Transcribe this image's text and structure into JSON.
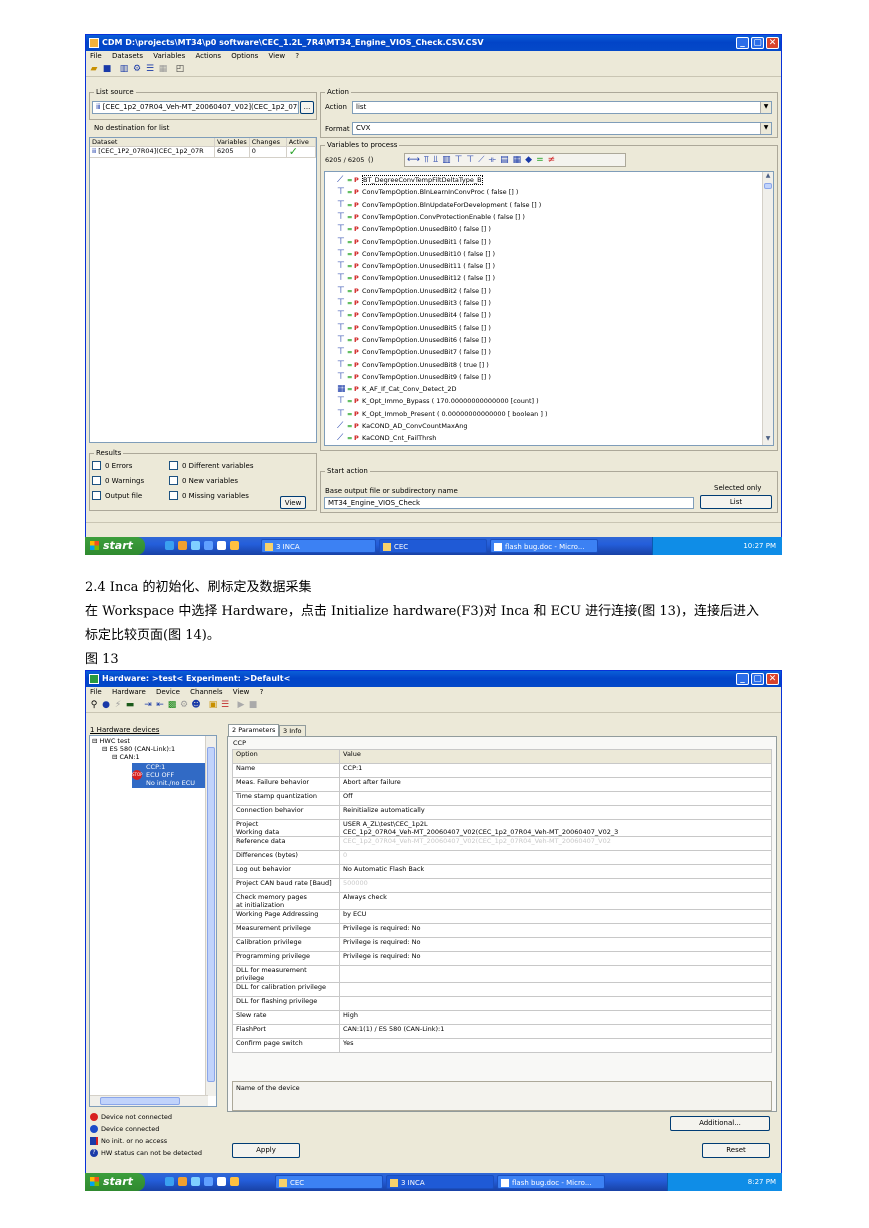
{
  "win1": {
    "title": "CDM D:\\projects\\MT34\\p0 software\\CEC_1.2L_7R4\\MT34_Engine_VIOS_Check.CSV.CSV",
    "menu": [
      "File",
      "Datasets",
      "Variables",
      "Actions",
      "Options",
      "View",
      "?"
    ],
    "list_source": {
      "label": "List source",
      "value": "[CEC_1p2_07R04_Veh-MT_20060407_V02](CEC_1p2_07R",
      "browse": "..."
    },
    "destination": {
      "label": "No destination for list"
    },
    "dataset_table": {
      "headers": [
        "Dataset",
        "Variables",
        "Changes",
        "Active"
      ],
      "rows": [
        {
          "name": "[CEC_1P2_07R04](CEC_1p2_07R",
          "variables": "6205",
          "changes": "0",
          "active": "✓"
        }
      ]
    },
    "results": {
      "label": "Results",
      "items": [
        "0 Errors",
        "0 Different variables",
        "0 Warnings",
        "0 New variables",
        "Output file",
        "0 Missing variables"
      ],
      "view_button": "View"
    },
    "action": {
      "group_label": "Action",
      "action_label": "Action",
      "action_value": "list",
      "format_label": "Format",
      "format_value": "CVX"
    },
    "variables": {
      "group_label": "Variables to process",
      "count": "6205 / 6205",
      "paren": "()",
      "items": [
        "BT_DegreeConvTempFiltDeltaType_B",
        "ConvTempOption.BlnLearnInConvProc ( false [] )",
        "ConvTempOption.BlnUpdateForDevelopment ( false [] )",
        "ConvTempOption.ConvProtectionEnable ( false [] )",
        "ConvTempOption.UnusedBit0 ( false [] )",
        "ConvTempOption.UnusedBit1 ( false [] )",
        "ConvTempOption.UnusedBit10 ( false [] )",
        "ConvTempOption.UnusedBit11 ( false [] )",
        "ConvTempOption.UnusedBit12 ( false [] )",
        "ConvTempOption.UnusedBit2 ( false [] )",
        "ConvTempOption.UnusedBit3 ( false [] )",
        "ConvTempOption.UnusedBit4 ( false [] )",
        "ConvTempOption.UnusedBit5 ( false [] )",
        "ConvTempOption.UnusedBit6 ( false [] )",
        "ConvTempOption.UnusedBit7 ( false [] )",
        "ConvTempOption.UnusedBit8 ( true [] )",
        "ConvTempOption.UnusedBit9 ( false [] )",
        "K_AF_If_Cat_Conv_Detect_2D",
        "K_Opt_Immo_Bypass ( 170.00000000000000 [count] )",
        "K_Opt_Immob_Present ( 0.00000000000000 [ boolean ] )",
        "KaCOND_AD_ConvCountMaxAng",
        "KaCOND_Cnt_FailThrsh"
      ]
    },
    "start_action": {
      "label": "Start action",
      "base_label": "Base output file or subdirectory name",
      "base_value": "MT34_Engine_VIOS_Check",
      "selected_only": "Selected only",
      "list_button": "List"
    }
  },
  "taskbar1": {
    "start": "start",
    "tasks": [
      "3 INCA",
      "CEC",
      "flash bug.doc - Micro..."
    ],
    "clock": "10:27 PM"
  },
  "doc": {
    "heading": "2.4 Inca 的初始化、刷标定及数据采集",
    "para1": "在 Workspace 中选择 Hardware，点击 Initialize hardware(F3)对 Inca 和 ECU 进行连接(图 13)，连接后进入",
    "para2": "标定比较页面(图 14)。",
    "figure": "图 13"
  },
  "win2": {
    "title": "Hardware: >test< Experiment: >Default<",
    "menu": [
      "File",
      "Hardware",
      "Device",
      "Channels",
      "View",
      "?"
    ],
    "devices_tab": "1 Hardware devices",
    "tree": {
      "root": "HWC test",
      "es": "ES 580 (CAN-Link):1",
      "can": "CAN:1",
      "ccp": "CCP:1",
      "ecu_off": "ECU OFF",
      "noinit": "No init./no ECU"
    },
    "tabs": [
      "2 Parameters",
      "3 Info"
    ],
    "section": "CCP",
    "params_header": [
      "Option",
      "Value"
    ],
    "params": [
      [
        "Name",
        "CCP:1"
      ],
      [
        "Meas. Failure behavior",
        "Abort after failure"
      ],
      [
        "Time stamp quantization",
        "Off"
      ],
      [
        "Connection behavior",
        "Reinitialize automatically"
      ],
      [
        "Project\nWorking data",
        "USER A_ZL\\test\\CEC_1p2L\nCEC_1p2_07R04_Veh-MT_20060407_V02(CEC_1p2_07R04_Veh-MT_20060407_V02_3"
      ],
      [
        "Reference data",
        "CEC_1p2_07R04_Veh-MT_20060407_V02(CEC_1p2_07R04_Veh-MT_20060407_V02"
      ],
      [
        "Differences (bytes)",
        "0"
      ],
      [
        "Log out behavior",
        "No Automatic Flash Back"
      ],
      [
        "Project CAN baud rate [Baud]",
        "500000"
      ],
      [
        "Check memory pages\nat initialization",
        "Always check"
      ],
      [
        "Working Page Addressing",
        "by ECU"
      ],
      [
        "Measurement privilege",
        "Privilege is required: No"
      ],
      [
        "Calibration privilege",
        "Privilege is required: No"
      ],
      [
        "Programming privilege",
        "Privilege is required: No"
      ],
      [
        "DLL for measurement privilege",
        ""
      ],
      [
        "DLL for calibration privilege",
        ""
      ],
      [
        "DLL for flashing privilege",
        ""
      ],
      [
        "Slew rate",
        "High"
      ],
      [
        "FlashPort",
        "CAN:1(1) / ES 580 (CAN-Link):1"
      ],
      [
        "Confirm page switch",
        "Yes"
      ]
    ],
    "description": "Name of the device",
    "additional": "Additional...",
    "apply": "Apply",
    "reset": "Reset",
    "legend": [
      "Device not connected",
      "Device connected",
      "No init. or no access",
      "HW status can not be detected"
    ]
  },
  "taskbar2": {
    "start": "start",
    "tasks": [
      "CEC",
      "3 INCA",
      "flash bug.doc - Micro..."
    ],
    "clock": "8:27 PM"
  }
}
